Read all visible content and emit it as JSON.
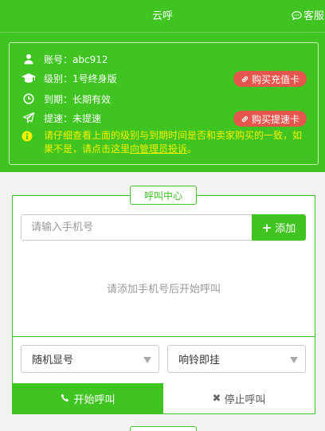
{
  "header": {
    "title": "云呼",
    "support_label": "客服"
  },
  "account_info": {
    "account": "账号：abc912",
    "level": "级别：1号终身版",
    "expiry": "到期：长期有效",
    "speedup": "提速：未提速",
    "buy_recharge_label": "购买充值卡",
    "buy_speedup_label": "购买提速卡",
    "warning_text": "请仔细查看上面的级别与到期时间是否和卖家购买的一致，如果不是，请点击这里",
    "warning_link": "向管理员投诉",
    "warning_tail": "。"
  },
  "call_center": {
    "title": "呼叫中心",
    "phone_placeholder": "请输入手机号",
    "add_label": "添加",
    "empty_message": "请添加手机号后开始呼叫",
    "caller_id_select": "随机显号",
    "ring_mode_select": "响铃即挂",
    "start_label": "开始呼叫",
    "stop_label": "停止呼叫"
  },
  "colors": {
    "brand_green": "#3fc421",
    "badge_red": "#e4564d",
    "warning_yellow": "#f5f000"
  }
}
